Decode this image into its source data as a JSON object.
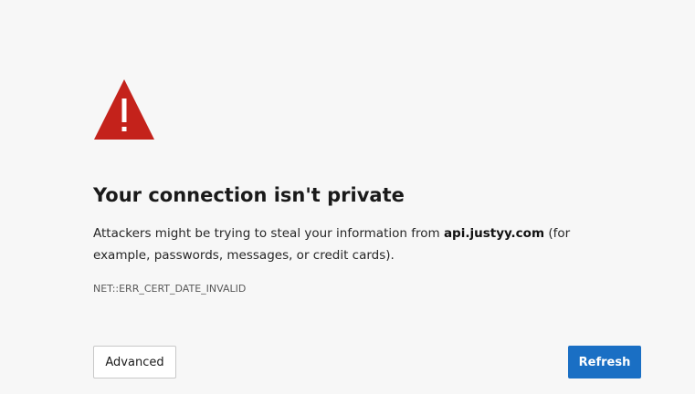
{
  "icon": {
    "name": "warning-triangle-icon",
    "color": "#c4221b",
    "mark_color": "#ffffff"
  },
  "title": "Your connection isn't private",
  "message": {
    "prefix": "Attackers might be trying to steal your information from ",
    "host": "api.justyy.com",
    "suffix": " (for example, passwords, messages, or credit cards)."
  },
  "error_code": "NET::ERR_CERT_DATE_INVALID",
  "buttons": {
    "advanced_label": "Advanced",
    "refresh_label": "Refresh"
  },
  "colors": {
    "background": "#f7f7f7",
    "primary_button": "#1a6fc4"
  }
}
